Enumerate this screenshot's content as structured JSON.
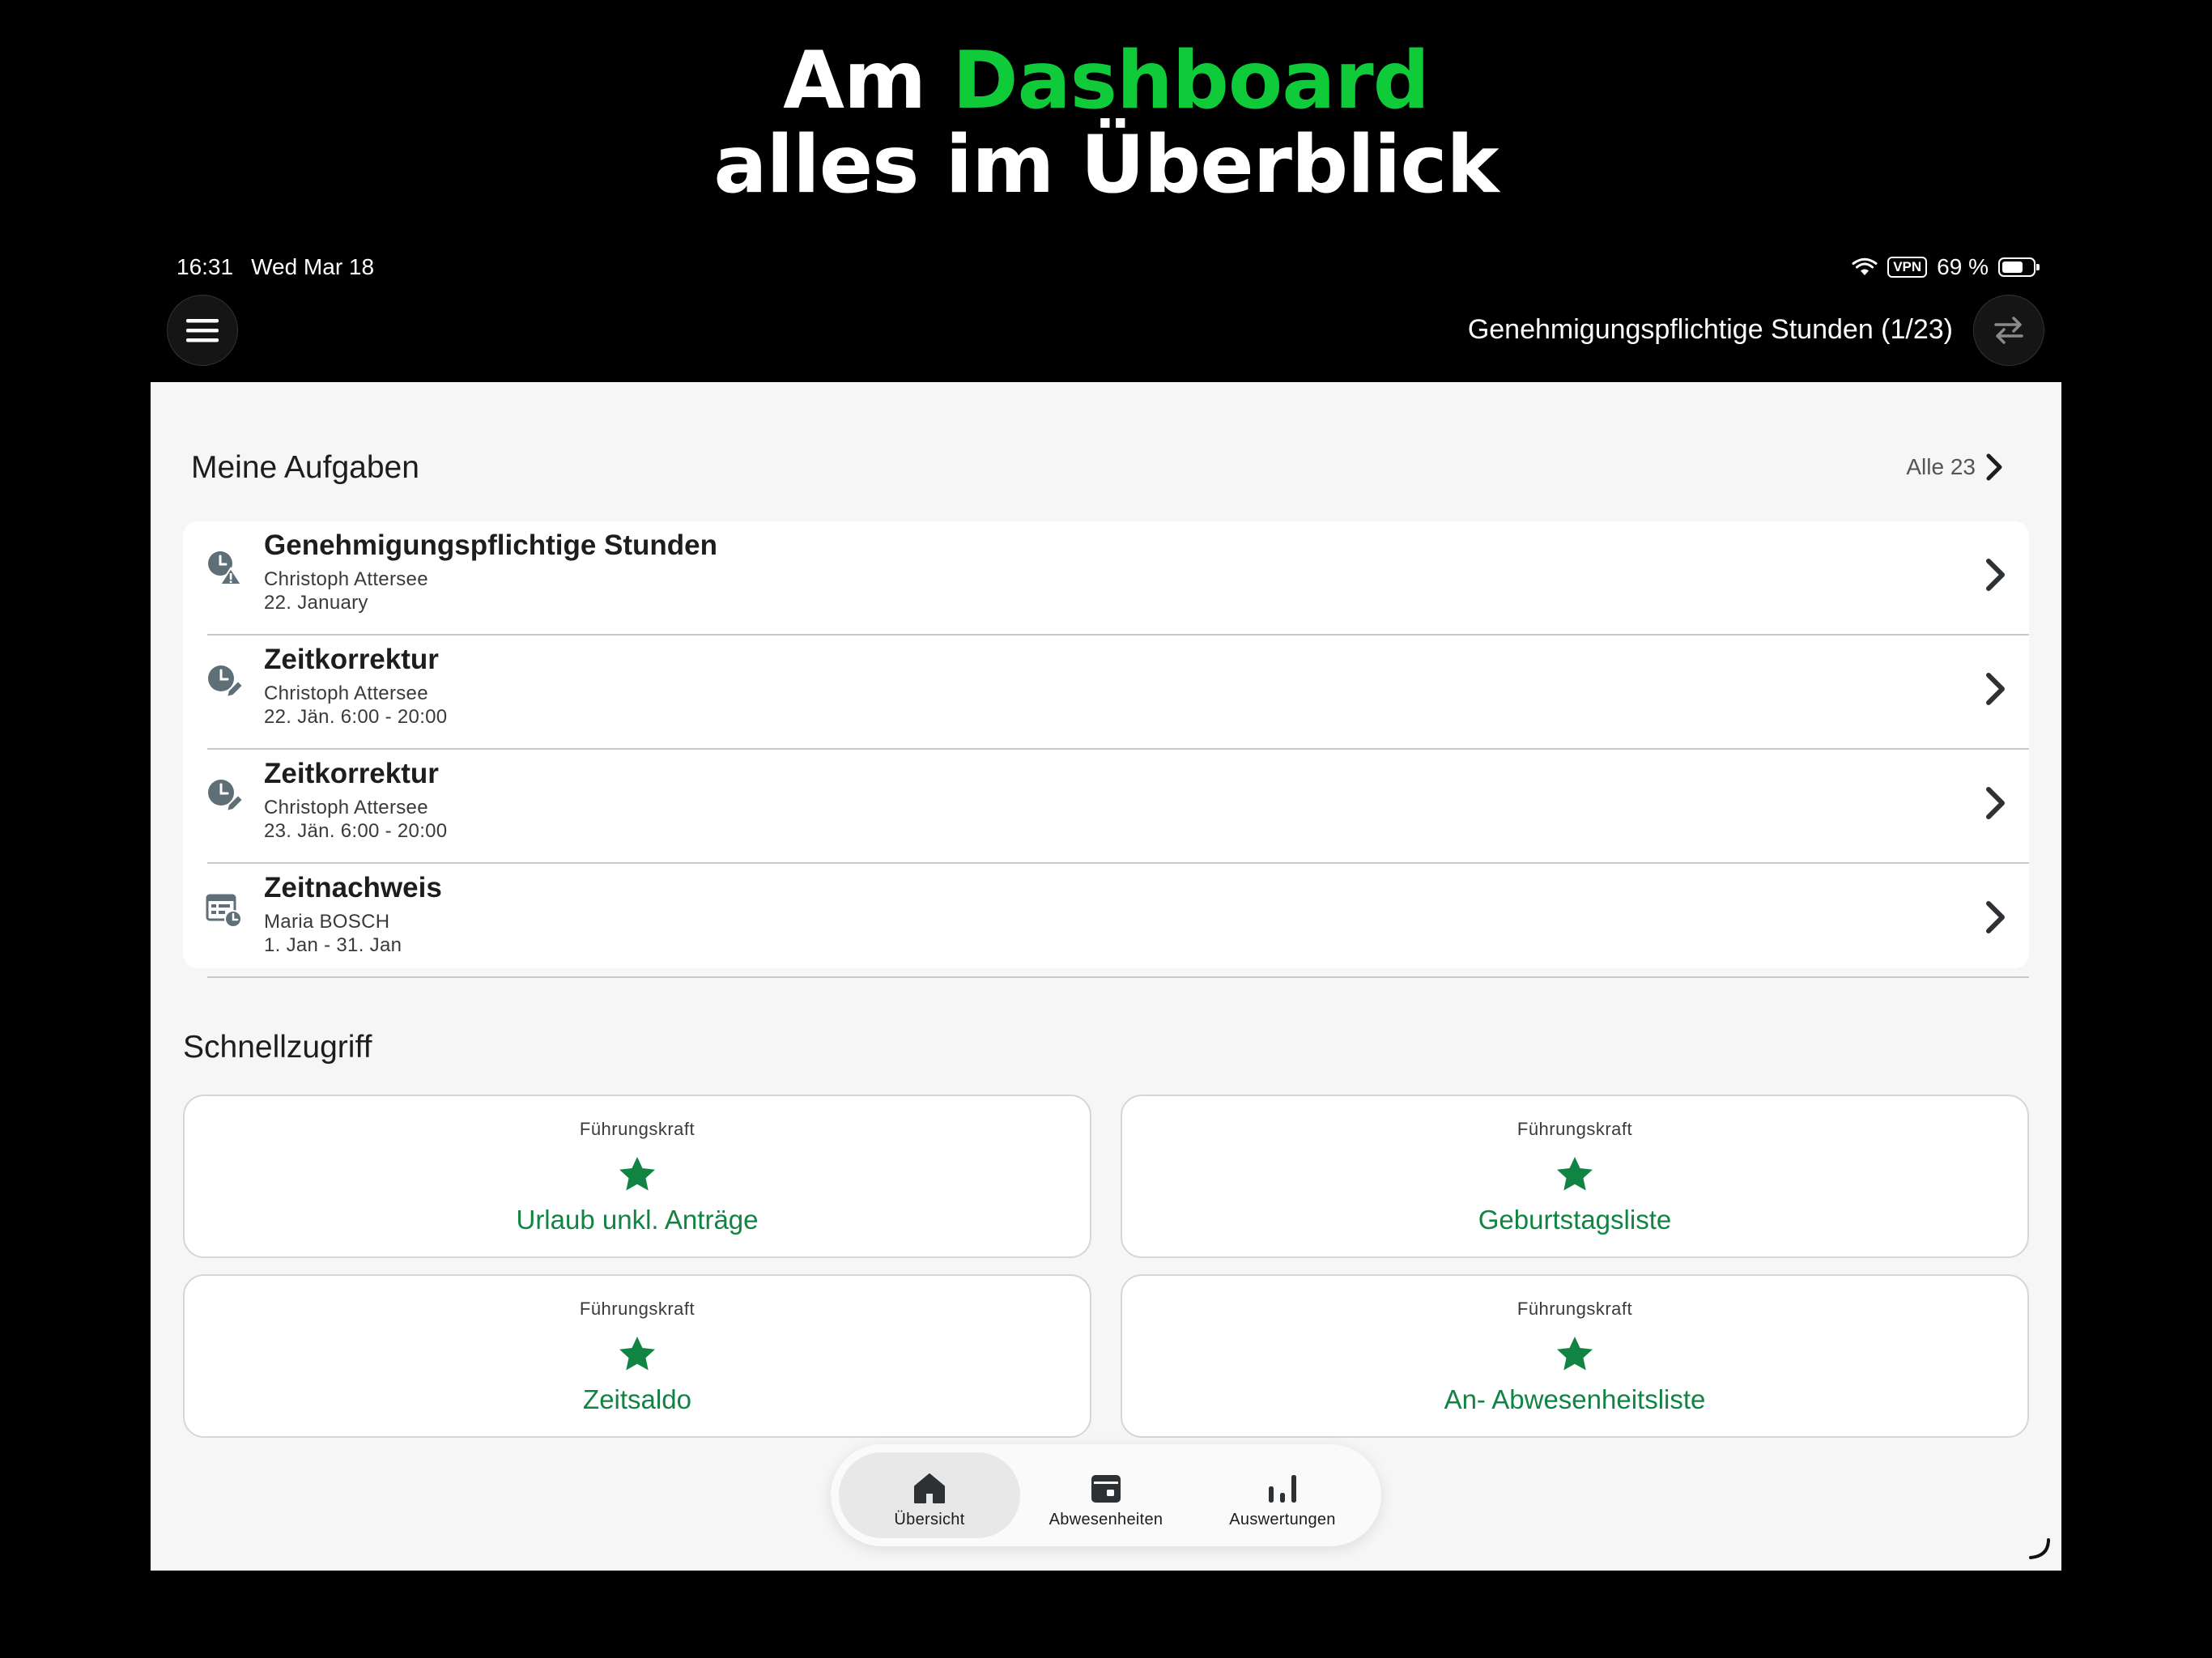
{
  "headline": {
    "prefix": "Am",
    "accent": "Dashboard",
    "line2": "alles im Überblick",
    "accent_color": "#0fcb3a"
  },
  "status_bar": {
    "time": "16:31",
    "date": "Wed Mar 18",
    "vpn": "VPN",
    "battery": "69 %",
    "battery_level": 0.69
  },
  "nav": {
    "menu_icon": "hamburger-icon",
    "title": "Genehmigungspflichtige Stunden (1/23)",
    "switch_icon": "swap-arrows-icon"
  },
  "tasks": {
    "title": "Meine Aufgaben",
    "all_label": "Alle 23",
    "items": [
      {
        "icon": "clock-warning-icon",
        "title": "Genehmigungspflichtige Stunden",
        "person": "Christoph Attersee",
        "detail": "22. January"
      },
      {
        "icon": "clock-edit-icon",
        "title": "Zeitkorrektur",
        "person": "Christoph Attersee",
        "detail": "22. Jän. 6:00 - 20:00"
      },
      {
        "icon": "clock-edit-icon",
        "title": "Zeitkorrektur",
        "person": "Christoph Attersee",
        "detail": "23. Jän. 6:00 - 20:00"
      },
      {
        "icon": "timesheet-icon",
        "title": "Zeitnachweis",
        "person": "Maria BOSCH",
        "detail": "1. Jan - 31. Jan"
      }
    ]
  },
  "quick_access": {
    "title": "Schnellzugriff",
    "accent_color": "#118443",
    "items": [
      {
        "label": "Führungskraft",
        "title": "Urlaub unkl. Anträge"
      },
      {
        "label": "Führungskraft",
        "title": "Geburtstagsliste"
      },
      {
        "label": "Führungskraft",
        "title": "Zeitsaldo"
      },
      {
        "label": "Führungskraft",
        "title": "An- Abwesenheitsliste"
      }
    ]
  },
  "tab_bar": {
    "active": "Übersicht",
    "items": [
      {
        "icon": "home-icon",
        "label": "Übersicht"
      },
      {
        "icon": "calendar-icon",
        "label": "Abwesenheiten"
      },
      {
        "icon": "bar-chart-icon",
        "label": "Auswertungen"
      }
    ]
  }
}
